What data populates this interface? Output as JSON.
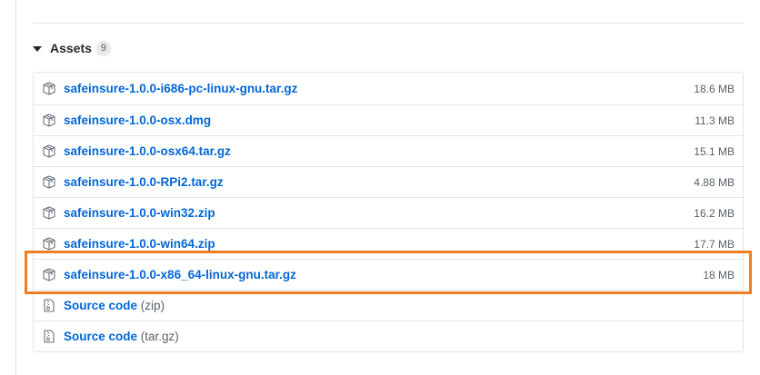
{
  "assets": {
    "title": "Assets",
    "count": "9",
    "files": [
      {
        "name": "safeinsure-1.0.0-i686-pc-linux-gnu.tar.gz",
        "size": "18.6 MB",
        "icon": "package-icon"
      },
      {
        "name": "safeinsure-1.0.0-osx.dmg",
        "size": "11.3 MB",
        "icon": "package-icon"
      },
      {
        "name": "safeinsure-1.0.0-osx64.tar.gz",
        "size": "15.1 MB",
        "icon": "package-icon"
      },
      {
        "name": "safeinsure-1.0.0-RPi2.tar.gz",
        "size": "4.88 MB",
        "icon": "package-icon"
      },
      {
        "name": "safeinsure-1.0.0-win32.zip",
        "size": "16.2 MB",
        "icon": "package-icon"
      },
      {
        "name": "safeinsure-1.0.0-win64.zip",
        "size": "17.7 MB",
        "icon": "package-icon"
      },
      {
        "name": "safeinsure-1.0.0-x86_64-linux-gnu.tar.gz",
        "size": "18 MB",
        "icon": "package-icon"
      }
    ],
    "source": [
      {
        "label": "Source code",
        "format": "(zip)",
        "icon": "file-zip-icon"
      },
      {
        "label": "Source code",
        "format": "(tar.gz)",
        "icon": "file-zip-icon"
      }
    ]
  },
  "colors": {
    "link": "#0366d6",
    "muted": "#586069",
    "border": "#e1e4e8",
    "highlight": "#f07d22"
  }
}
